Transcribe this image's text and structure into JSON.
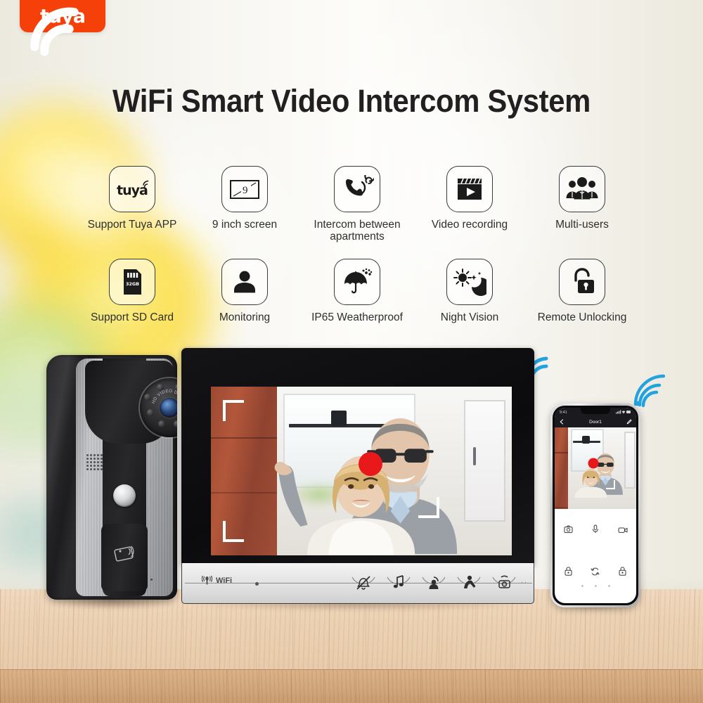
{
  "brand": {
    "logo_text": "tuya",
    "logo_bg": "#f5400a",
    "logo_icon": "wifi-signal-icon"
  },
  "headline": "WiFi Smart Video Intercom System",
  "features": {
    "row1": [
      {
        "label": "Support Tuya APP",
        "icon": "tuya-logo-icon"
      },
      {
        "label": "9 inch screen",
        "icon": "screen-diagonal-icon",
        "value": "9"
      },
      {
        "label": "Intercom between apartments",
        "icon": "phone-ring-icon"
      },
      {
        "label": "Video recording",
        "icon": "clapperboard-play-icon"
      },
      {
        "label": "Multi-users",
        "icon": "group-users-icon"
      }
    ],
    "row2": [
      {
        "label": "Support SD Card",
        "icon": "sd-card-icon",
        "value": "32GB"
      },
      {
        "label": "Monitoring",
        "icon": "person-silhouette-icon"
      },
      {
        "label": "IP65 Weatherproof",
        "icon": "umbrella-rain-icon"
      },
      {
        "label": "Night Vision",
        "icon": "sun-moon-icon"
      },
      {
        "label": "Remote Unlocking",
        "icon": "open-padlock-icon"
      }
    ]
  },
  "doorbell": {
    "name": "outdoor-door-station",
    "lens_ring_text": "HD VIDEO DOOR PHONE",
    "parts": {
      "camera": "ir-camera-icon",
      "speaker": "speaker-grille-icon",
      "call_button": "call-button",
      "rfid": "rfid-card-reader-icon",
      "microphone": "microphone-pinhole"
    }
  },
  "monitor": {
    "name": "indoor-monitor",
    "wifi_label": "WiFi",
    "recording_indicator": "rec-dot",
    "rec_color": "#e8181b",
    "keys": [
      {
        "label": "",
        "icon": "mute-bell-off-icon"
      },
      {
        "label": "",
        "icon": "music-note-icon"
      },
      {
        "label": "",
        "icon": "unlock-person-icon"
      },
      {
        "label": "",
        "icon": "talk-intercom-icon"
      },
      {
        "label": "",
        "icon": "monitor-camera-icon"
      }
    ],
    "more_dots": "··"
  },
  "phone": {
    "name": "mobile-app",
    "status_left": "9:41",
    "status_right": "",
    "nav_title": "Door1",
    "nav_back": "back-arrow-icon",
    "nav_edit": "edit-pencil-icon",
    "controls": [
      {
        "icon": "snapshot-camera-icon"
      },
      {
        "icon": "microphone-icon"
      },
      {
        "icon": "video-record-icon"
      },
      {
        "icon": "lock-icon"
      },
      {
        "icon": "switch-refresh-icon"
      },
      {
        "icon": "lock-icon"
      }
    ]
  },
  "wifi_signals": [
    {
      "name": "wifi-arcs-monitor",
      "color": "#23a3de"
    },
    {
      "name": "wifi-arcs-phone",
      "color": "#23a3de"
    }
  ],
  "colors": {
    "accent_orange": "#f5400a",
    "wifi_blue": "#23a3de",
    "rec_red": "#e8181b",
    "text_dark": "#231f20",
    "table_wood": "#ecd2b4"
  }
}
